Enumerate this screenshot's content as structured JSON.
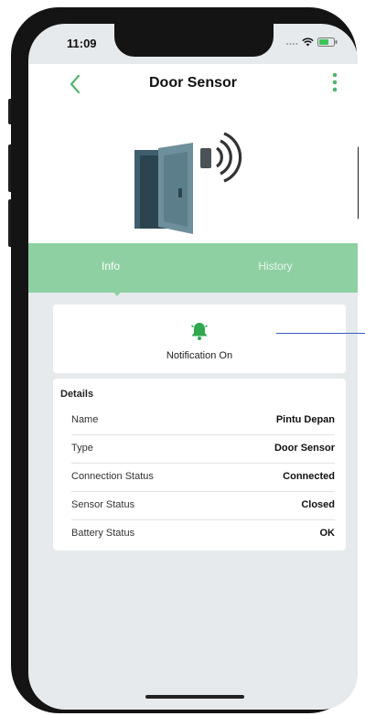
{
  "status_bar": {
    "time": "11:09"
  },
  "header": {
    "title": "Door Sensor"
  },
  "tabs": [
    {
      "label": "Info",
      "active": true
    },
    {
      "label": "History",
      "active": false
    }
  ],
  "notification": {
    "label": "Notification On",
    "icon": "bell-icon"
  },
  "details": {
    "title": "Details",
    "rows": [
      {
        "label": "Name",
        "value": "Pintu Depan"
      },
      {
        "label": "Type",
        "value": "Door Sensor"
      },
      {
        "label": "Connection Status",
        "value": "Connected"
      },
      {
        "label": "Sensor Status",
        "value": "Closed"
      },
      {
        "label": "Battery Status",
        "value": "OK"
      }
    ]
  },
  "colors": {
    "accent": "#2fa84f",
    "tab_bar": "#8fd0a3",
    "background": "#e6eaec",
    "annotation": "#3a5bc7"
  }
}
